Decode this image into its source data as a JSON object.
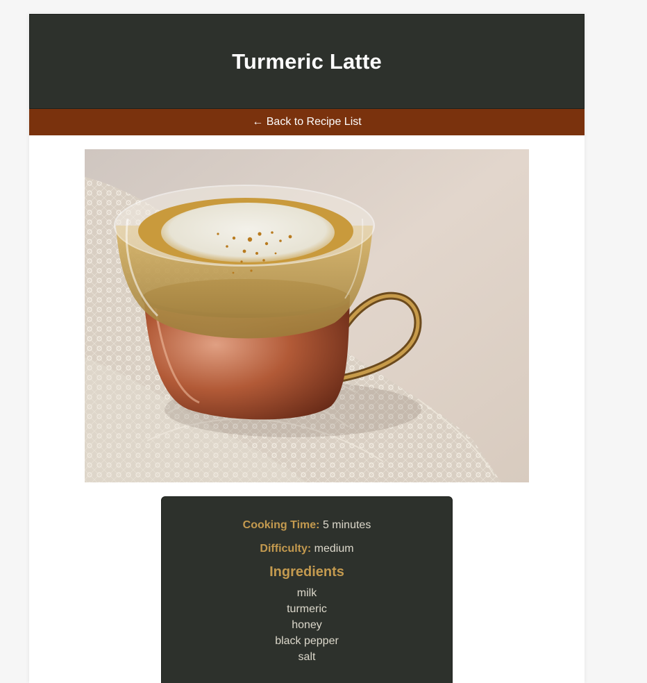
{
  "recipe": {
    "title": "Turmeric Latte",
    "back_link": "← Back to Recipe List",
    "cooking_time_label": "Cooking Time:",
    "cooking_time_value": "5 minutes",
    "difficulty_label": "Difficulty:",
    "difficulty_value": "medium",
    "ingredients_heading": "Ingredients",
    "ingredients": [
      "milk",
      "turmeric",
      "honey",
      "black pepper",
      "salt"
    ]
  },
  "colors": {
    "header_bg": "#2d312c",
    "backbar_bg": "#7a320d",
    "accent_gold": "#c49a4f",
    "card_text": "#ddd9cc"
  }
}
